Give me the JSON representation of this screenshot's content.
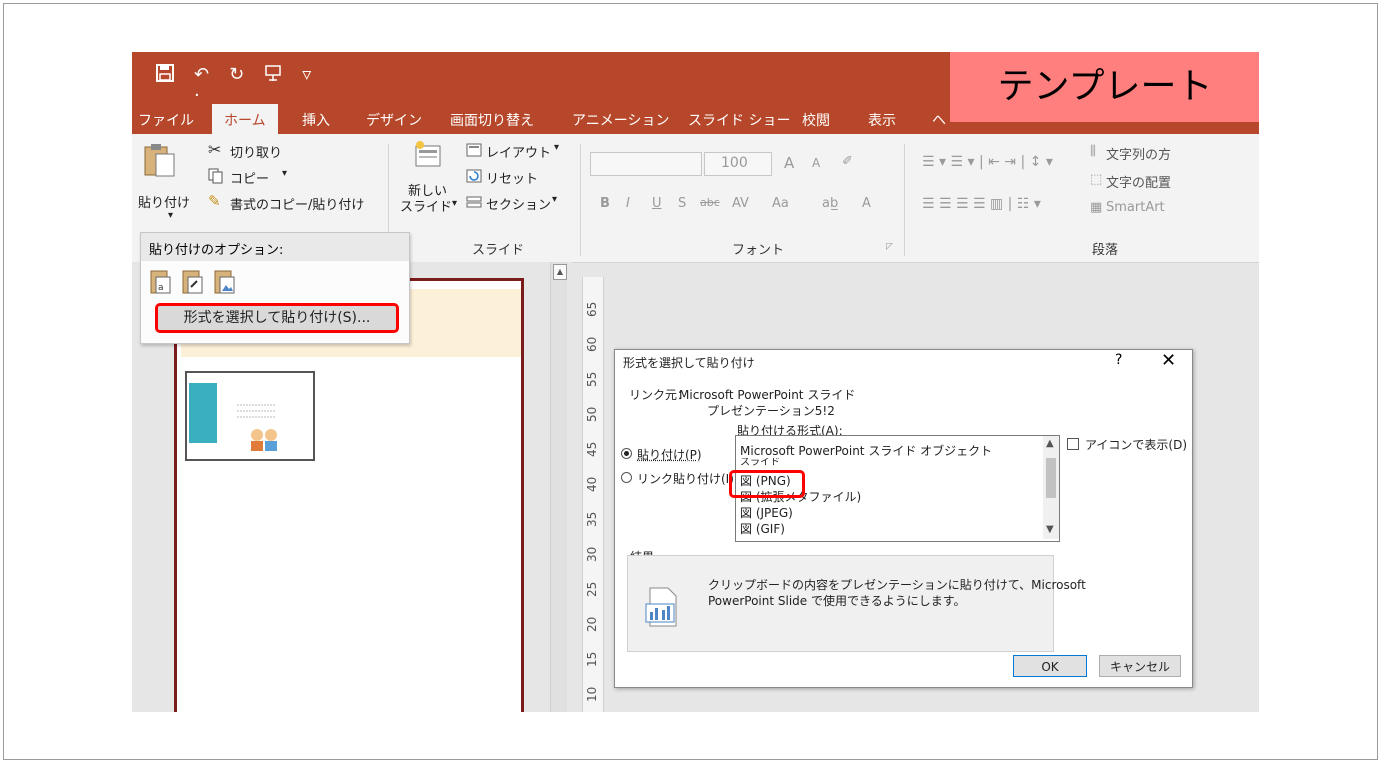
{
  "overlay_label": "テンプレート",
  "quick_access": {
    "save_icon": "save-icon",
    "undo": "↶",
    "undo_arrow": "·",
    "redo": "↻",
    "slideshow_icon": "present-icon",
    "more": "▿"
  },
  "tabs": [
    "ファイル",
    "ホーム",
    "挿入",
    "デザイン",
    "画面切り替え",
    "アニメーション",
    "スライド ショー",
    "校閲",
    "表示",
    "ヘ"
  ],
  "ribbon": {
    "paste": "貼り付け",
    "paste_arrow": "▾",
    "cut": "切り取り",
    "copy": "コピー",
    "copy_arrow": "▾",
    "format_painter": "書式のコピー/貼り付け",
    "new_slide_line1": "新しい",
    "new_slide_line2": "スライド",
    "new_slide_arrow": "▾",
    "layout": "レイアウト",
    "layout_arrow": "▾",
    "reset": "リセット",
    "section": "セクション",
    "section_arrow": "▾",
    "slide_group": "スライド",
    "font_group": "フォント",
    "font_size": "100",
    "paragraph_group": "段落",
    "text_direction": "文字列の方",
    "align_text": "文字の配置",
    "smartart": "SmartArt",
    "fmt_bold": "B",
    "fmt_italic": "I",
    "fmt_underline": "U",
    "fmt_shadow": "S",
    "fmt_strike": "abc",
    "fmt_spacing": "AV",
    "fmt_case": "Aa",
    "fmt_grow": "A",
    "fmt_shrink": "A",
    "fmt_color": "A"
  },
  "paste_menu": {
    "header": "貼り付けのオプション:",
    "item": "形式を選択して貼り付け(S)..."
  },
  "ruler_numbers": [
    "65",
    "60",
    "55",
    "50",
    "45",
    "40",
    "35",
    "30",
    "25",
    "20",
    "15",
    "10"
  ],
  "dialog": {
    "title": "形式を選択して貼り付け",
    "help": "?",
    "close": "✕",
    "source_label": "リンク元：",
    "source_app": "Microsoft PowerPoint スライド",
    "source_file": "プレゼンテーション5!2",
    "as_label": "貼り付ける形式(A):",
    "paste_option": "貼り付け(P)",
    "link_option": "リンク貼り付け(I)",
    "display_icon": "アイコンで表示(D)",
    "formats": [
      "Microsoft PowerPoint スライド オブジェクト",
      "スライド",
      "図 (PNG)",
      "図 (拡張メタファイル)",
      "図 (JPEG)",
      "図 (GIF)"
    ],
    "result_label": "結果",
    "result_line1": "クリップボードの内容をプレゼンテーションに貼り付けて、Microsoft",
    "result_line2": "PowerPoint Slide で使用できるようにします。",
    "ok": "OK",
    "cancel": "キャンセル"
  }
}
